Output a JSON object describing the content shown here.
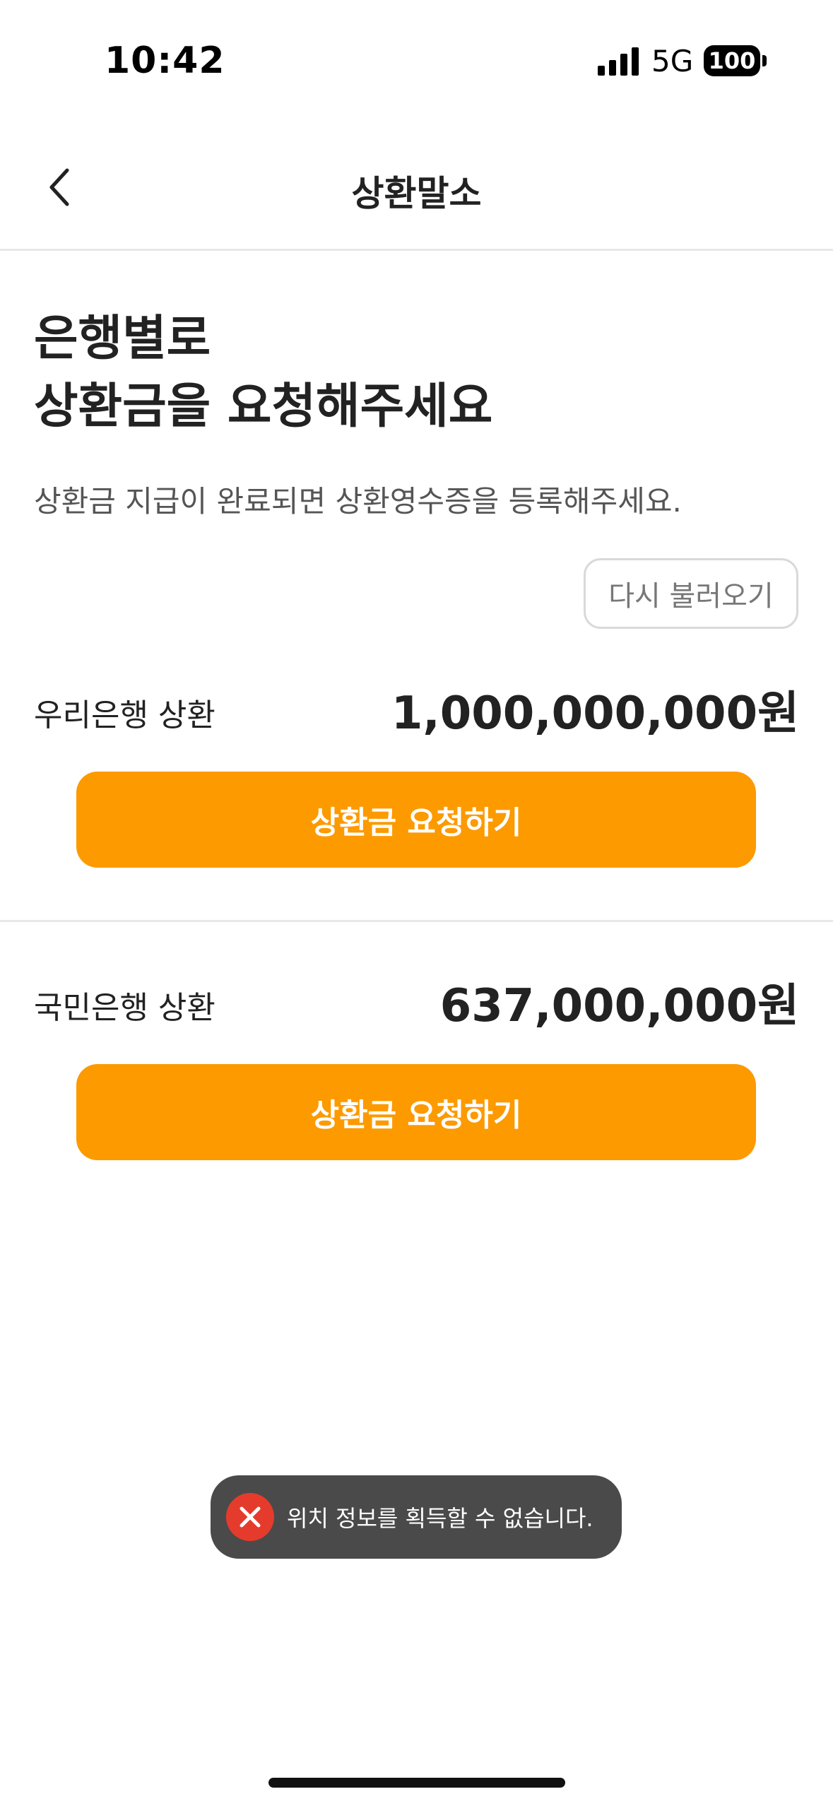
{
  "status_bar": {
    "time": "10:42",
    "network": "5G",
    "battery": "100"
  },
  "nav": {
    "title": "상환말소",
    "back_icon": "chevron-left-icon"
  },
  "header": {
    "title_line1": "은행별로",
    "title_line2": "상환금을 요청해주세요",
    "description": "상환금 지급이 완료되면 상환영수증을 등록해주세요."
  },
  "reload_button": {
    "label": "다시 불러오기"
  },
  "banks": [
    {
      "label": "우리은행 상환",
      "amount": "1,000,000,000원",
      "button_label": "상환금 요청하기"
    },
    {
      "label": "국민은행 상환",
      "amount": "637,000,000원",
      "button_label": "상환금 요청하기"
    }
  ],
  "toast": {
    "icon": "error-x-icon",
    "message": "위치 정보를 획득할 수 없습니다."
  },
  "colors": {
    "accent": "#fc9a00",
    "error": "#e53b2c",
    "toast_bg": "#4a4a4a"
  }
}
